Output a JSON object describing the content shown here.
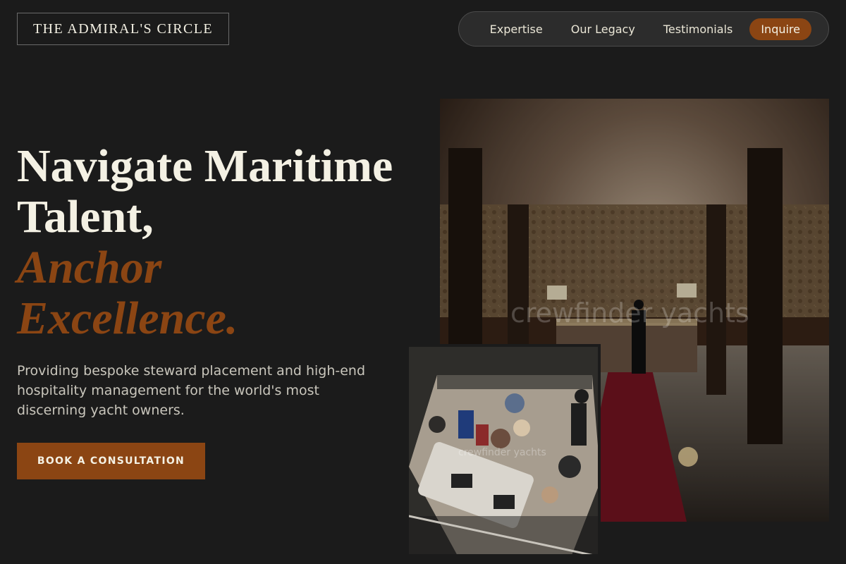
{
  "brand": {
    "name": "THE ADMIRAL'S CIRCLE"
  },
  "nav": {
    "items": [
      {
        "label": "Expertise"
      },
      {
        "label": "Our Legacy"
      },
      {
        "label": "Testimonials"
      }
    ],
    "cta_label": "Inquire"
  },
  "hero": {
    "headline_line1": "Navigate Maritime",
    "headline_line2": "Talent,",
    "headline_accent1": "Anchor",
    "headline_accent2": "Excellence.",
    "subtitle": "Providing bespoke steward placement and high-end hospitality management for the world's most discerning yacht owners.",
    "cta_label": "BOOK A CONSULTATION"
  },
  "images": {
    "main_watermark": "crewfinder yachts",
    "small_watermark": "crewfinder yachts"
  },
  "colors": {
    "background": "#1b1b1b",
    "accent": "#8b4513",
    "text": "#f4f1e4"
  }
}
